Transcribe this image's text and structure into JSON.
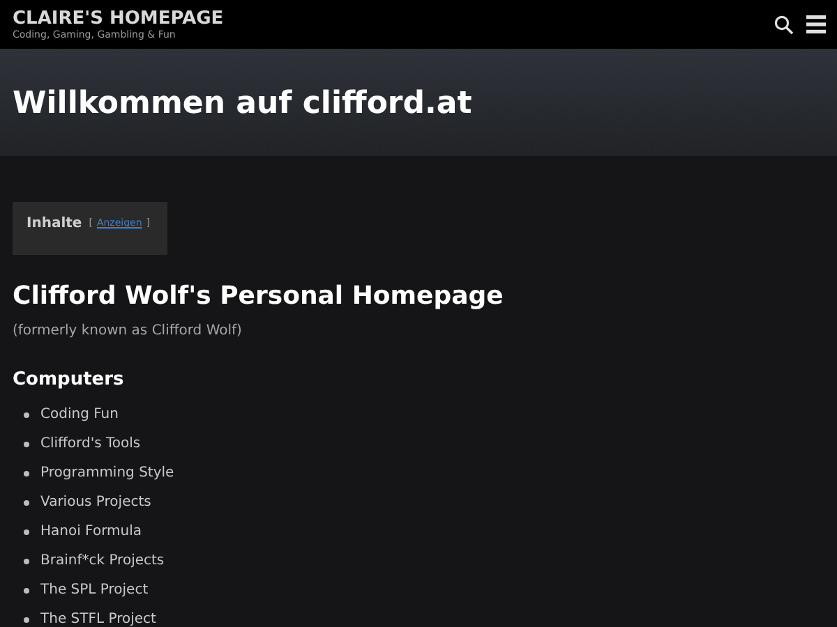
{
  "site": {
    "title": "CLAIRE'S HOMEPAGE",
    "tagline": "Coding, Gaming, Gambling & Fun"
  },
  "banner": {
    "title": "Willkommen auf clifford.at"
  },
  "toc": {
    "label": "Inhalte",
    "open_bracket": "[",
    "link": "Anzeigen",
    "close_bracket": "]"
  },
  "heading": "Clifford Wolf's Personal Homepage",
  "subtitle": "(formerly known as Clifford Wolf)",
  "section": {
    "title": "Computers",
    "items": [
      "Coding Fun",
      "Clifford's Tools",
      "Programming Style",
      "Various Projects",
      "Hanoi Formula",
      "Brainf*ck Projects",
      "The SPL Project",
      "The STFL Project"
    ]
  }
}
